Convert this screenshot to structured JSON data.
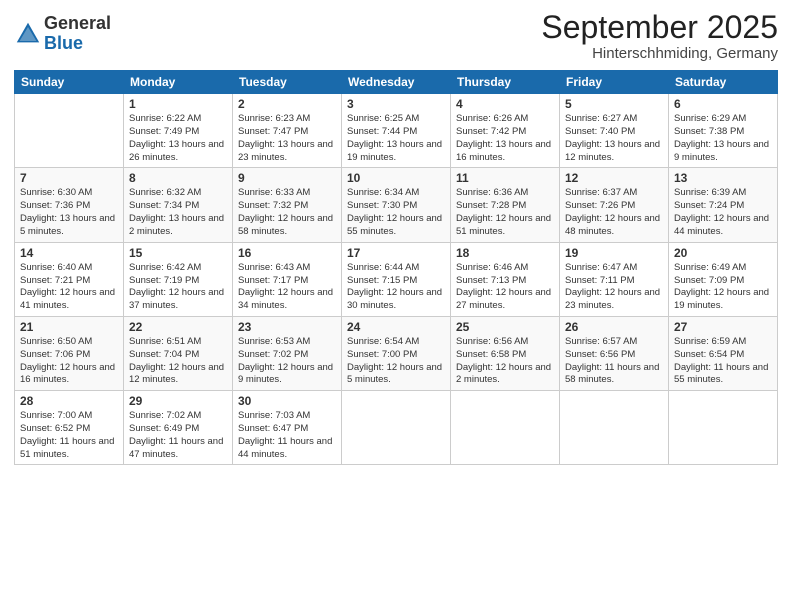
{
  "logo": {
    "general": "General",
    "blue": "Blue"
  },
  "header": {
    "month": "September 2025",
    "location": "Hinterschhmiding, Germany"
  },
  "days_of_week": [
    "Sunday",
    "Monday",
    "Tuesday",
    "Wednesday",
    "Thursday",
    "Friday",
    "Saturday"
  ],
  "weeks": [
    [
      {
        "day": "",
        "sunrise": "",
        "sunset": "",
        "daylight": ""
      },
      {
        "day": "1",
        "sunrise": "Sunrise: 6:22 AM",
        "sunset": "Sunset: 7:49 PM",
        "daylight": "Daylight: 13 hours and 26 minutes."
      },
      {
        "day": "2",
        "sunrise": "Sunrise: 6:23 AM",
        "sunset": "Sunset: 7:47 PM",
        "daylight": "Daylight: 13 hours and 23 minutes."
      },
      {
        "day": "3",
        "sunrise": "Sunrise: 6:25 AM",
        "sunset": "Sunset: 7:44 PM",
        "daylight": "Daylight: 13 hours and 19 minutes."
      },
      {
        "day": "4",
        "sunrise": "Sunrise: 6:26 AM",
        "sunset": "Sunset: 7:42 PM",
        "daylight": "Daylight: 13 hours and 16 minutes."
      },
      {
        "day": "5",
        "sunrise": "Sunrise: 6:27 AM",
        "sunset": "Sunset: 7:40 PM",
        "daylight": "Daylight: 13 hours and 12 minutes."
      },
      {
        "day": "6",
        "sunrise": "Sunrise: 6:29 AM",
        "sunset": "Sunset: 7:38 PM",
        "daylight": "Daylight: 13 hours and 9 minutes."
      }
    ],
    [
      {
        "day": "7",
        "sunrise": "Sunrise: 6:30 AM",
        "sunset": "Sunset: 7:36 PM",
        "daylight": "Daylight: 13 hours and 5 minutes."
      },
      {
        "day": "8",
        "sunrise": "Sunrise: 6:32 AM",
        "sunset": "Sunset: 7:34 PM",
        "daylight": "Daylight: 13 hours and 2 minutes."
      },
      {
        "day": "9",
        "sunrise": "Sunrise: 6:33 AM",
        "sunset": "Sunset: 7:32 PM",
        "daylight": "Daylight: 12 hours and 58 minutes."
      },
      {
        "day": "10",
        "sunrise": "Sunrise: 6:34 AM",
        "sunset": "Sunset: 7:30 PM",
        "daylight": "Daylight: 12 hours and 55 minutes."
      },
      {
        "day": "11",
        "sunrise": "Sunrise: 6:36 AM",
        "sunset": "Sunset: 7:28 PM",
        "daylight": "Daylight: 12 hours and 51 minutes."
      },
      {
        "day": "12",
        "sunrise": "Sunrise: 6:37 AM",
        "sunset": "Sunset: 7:26 PM",
        "daylight": "Daylight: 12 hours and 48 minutes."
      },
      {
        "day": "13",
        "sunrise": "Sunrise: 6:39 AM",
        "sunset": "Sunset: 7:24 PM",
        "daylight": "Daylight: 12 hours and 44 minutes."
      }
    ],
    [
      {
        "day": "14",
        "sunrise": "Sunrise: 6:40 AM",
        "sunset": "Sunset: 7:21 PM",
        "daylight": "Daylight: 12 hours and 41 minutes."
      },
      {
        "day": "15",
        "sunrise": "Sunrise: 6:42 AM",
        "sunset": "Sunset: 7:19 PM",
        "daylight": "Daylight: 12 hours and 37 minutes."
      },
      {
        "day": "16",
        "sunrise": "Sunrise: 6:43 AM",
        "sunset": "Sunset: 7:17 PM",
        "daylight": "Daylight: 12 hours and 34 minutes."
      },
      {
        "day": "17",
        "sunrise": "Sunrise: 6:44 AM",
        "sunset": "Sunset: 7:15 PM",
        "daylight": "Daylight: 12 hours and 30 minutes."
      },
      {
        "day": "18",
        "sunrise": "Sunrise: 6:46 AM",
        "sunset": "Sunset: 7:13 PM",
        "daylight": "Daylight: 12 hours and 27 minutes."
      },
      {
        "day": "19",
        "sunrise": "Sunrise: 6:47 AM",
        "sunset": "Sunset: 7:11 PM",
        "daylight": "Daylight: 12 hours and 23 minutes."
      },
      {
        "day": "20",
        "sunrise": "Sunrise: 6:49 AM",
        "sunset": "Sunset: 7:09 PM",
        "daylight": "Daylight: 12 hours and 19 minutes."
      }
    ],
    [
      {
        "day": "21",
        "sunrise": "Sunrise: 6:50 AM",
        "sunset": "Sunset: 7:06 PM",
        "daylight": "Daylight: 12 hours and 16 minutes."
      },
      {
        "day": "22",
        "sunrise": "Sunrise: 6:51 AM",
        "sunset": "Sunset: 7:04 PM",
        "daylight": "Daylight: 12 hours and 12 minutes."
      },
      {
        "day": "23",
        "sunrise": "Sunrise: 6:53 AM",
        "sunset": "Sunset: 7:02 PM",
        "daylight": "Daylight: 12 hours and 9 minutes."
      },
      {
        "day": "24",
        "sunrise": "Sunrise: 6:54 AM",
        "sunset": "Sunset: 7:00 PM",
        "daylight": "Daylight: 12 hours and 5 minutes."
      },
      {
        "day": "25",
        "sunrise": "Sunrise: 6:56 AM",
        "sunset": "Sunset: 6:58 PM",
        "daylight": "Daylight: 12 hours and 2 minutes."
      },
      {
        "day": "26",
        "sunrise": "Sunrise: 6:57 AM",
        "sunset": "Sunset: 6:56 PM",
        "daylight": "Daylight: 11 hours and 58 minutes."
      },
      {
        "day": "27",
        "sunrise": "Sunrise: 6:59 AM",
        "sunset": "Sunset: 6:54 PM",
        "daylight": "Daylight: 11 hours and 55 minutes."
      }
    ],
    [
      {
        "day": "28",
        "sunrise": "Sunrise: 7:00 AM",
        "sunset": "Sunset: 6:52 PM",
        "daylight": "Daylight: 11 hours and 51 minutes."
      },
      {
        "day": "29",
        "sunrise": "Sunrise: 7:02 AM",
        "sunset": "Sunset: 6:49 PM",
        "daylight": "Daylight: 11 hours and 47 minutes."
      },
      {
        "day": "30",
        "sunrise": "Sunrise: 7:03 AM",
        "sunset": "Sunset: 6:47 PM",
        "daylight": "Daylight: 11 hours and 44 minutes."
      },
      {
        "day": "",
        "sunrise": "",
        "sunset": "",
        "daylight": ""
      },
      {
        "day": "",
        "sunrise": "",
        "sunset": "",
        "daylight": ""
      },
      {
        "day": "",
        "sunrise": "",
        "sunset": "",
        "daylight": ""
      },
      {
        "day": "",
        "sunrise": "",
        "sunset": "",
        "daylight": ""
      }
    ]
  ]
}
